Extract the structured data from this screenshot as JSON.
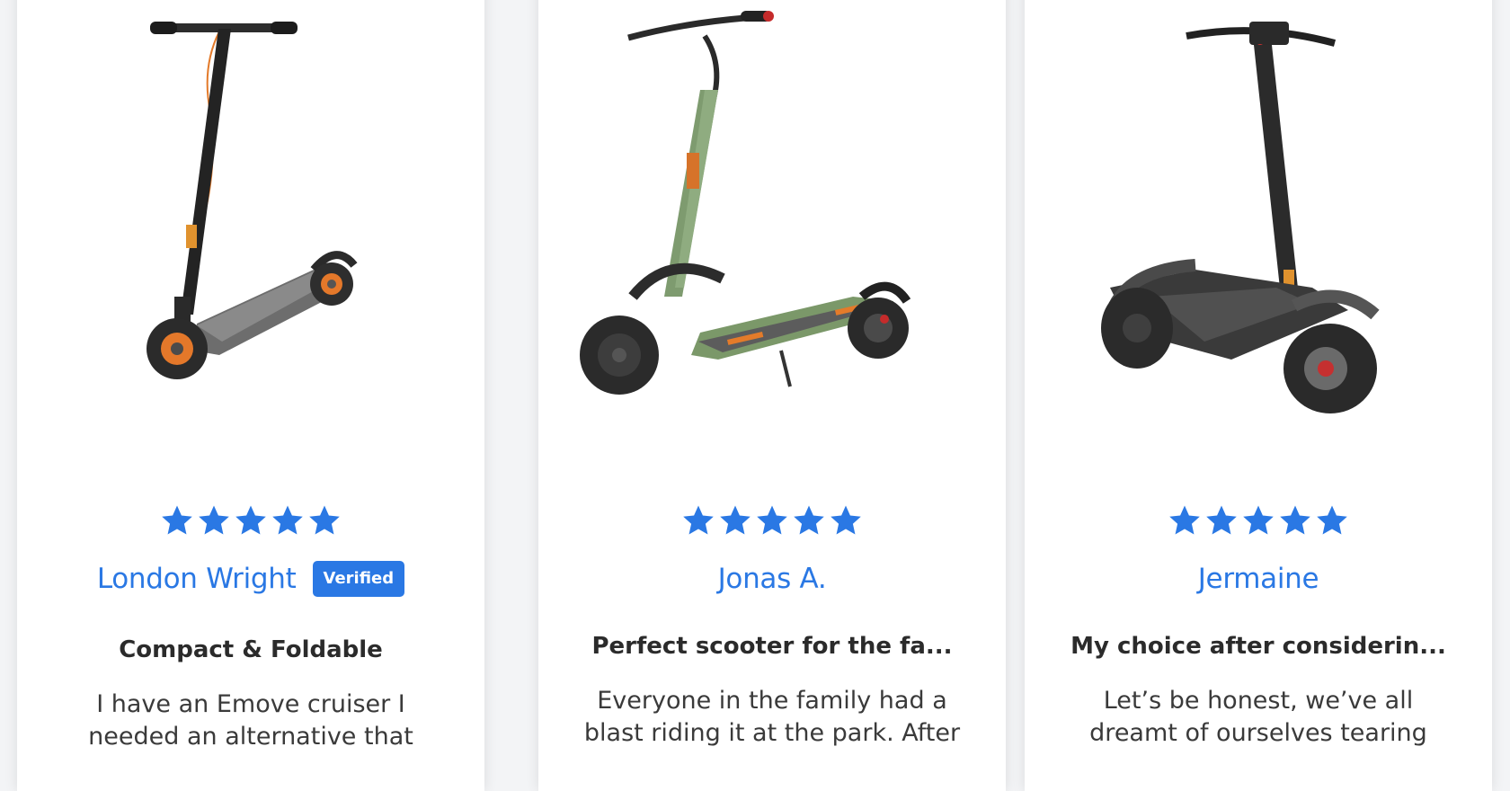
{
  "colors": {
    "accent": "#2a78e4",
    "star": "#2a78e4",
    "title_text": "#2b2b2b",
    "body_text": "#3a3a3a"
  },
  "reviews": [
    {
      "image_icon": "electric-scooter-image",
      "rating": 5,
      "reviewer": "London Wright",
      "badge": "Verified",
      "title": "Compact & Foldable",
      "body": "I have an Emove cruiser I needed an alternative that"
    },
    {
      "image_icon": "electric-scooter-image",
      "rating": 5,
      "reviewer": "Jonas A.",
      "badge": "",
      "title": "Perfect scooter for the fa...",
      "body": "Everyone in the family had a blast riding it at the park. After"
    },
    {
      "image_icon": "electric-scooter-image",
      "rating": 5,
      "reviewer": "Jermaine",
      "badge": "",
      "title": "My choice after considerin...",
      "body": "Let’s be honest, we’ve all dreamt of ourselves tearing"
    }
  ]
}
